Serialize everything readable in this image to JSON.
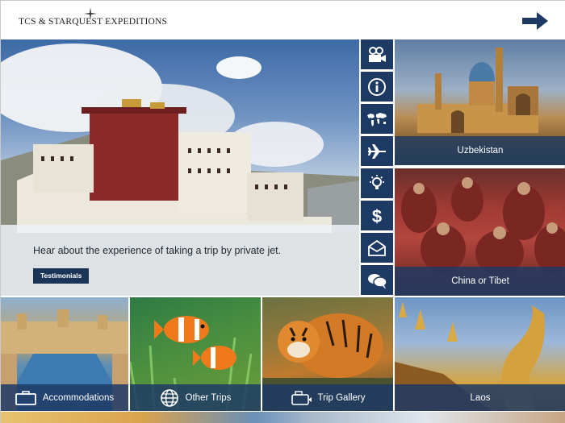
{
  "header": {
    "logo_text": "TCS & STARQUEST EXPEDITIONS",
    "next_icon": "arrow-right-icon"
  },
  "hero": {
    "caption": "Hear about the experience of taking a trip by private jet.",
    "button_label": "Testimonials"
  },
  "iconbar": {
    "items": [
      {
        "icon": "video-camera-icon"
      },
      {
        "icon": "info-icon"
      },
      {
        "icon": "world-map-icon"
      },
      {
        "icon": "airplane-icon"
      },
      {
        "icon": "lightbulb-icon"
      },
      {
        "icon": "dollar-icon"
      },
      {
        "icon": "envelope-icon"
      },
      {
        "icon": "chat-bubbles-icon"
      }
    ]
  },
  "destinations": {
    "uzbekistan": "Uzbekistan",
    "tibet": "China or Tibet",
    "laos": "Laos"
  },
  "bottom_tiles": {
    "accommodations": "Accommodations",
    "other_trips": "Other Trips",
    "trip_gallery": "Trip Gallery"
  },
  "colors": {
    "navy": "#1d3a64",
    "button_navy": "#1b3559"
  }
}
